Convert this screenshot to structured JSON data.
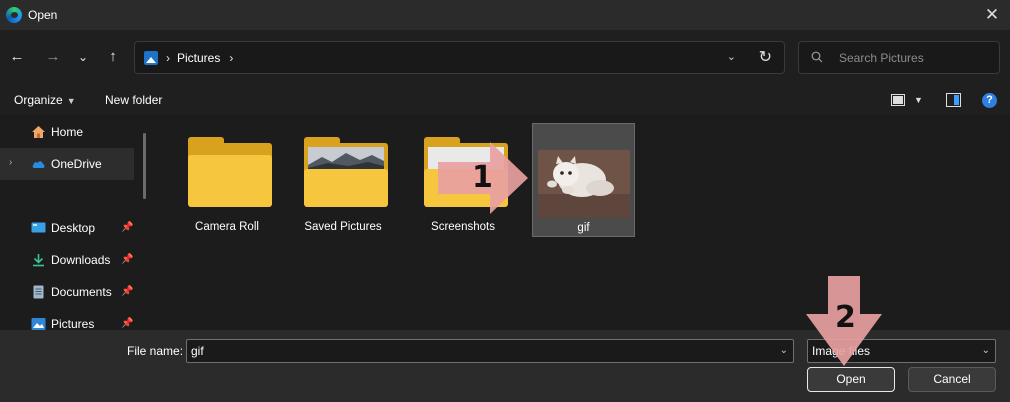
{
  "window": {
    "title": "Open"
  },
  "nav": {
    "breadcrumb_sep": "›",
    "location": "Pictures",
    "location_sep": "›",
    "search_placeholder": "Search Pictures"
  },
  "toolbar": {
    "organize_label": "Organize",
    "new_folder_label": "New folder",
    "help_label": "?"
  },
  "sidebar": {
    "items": [
      {
        "label": "Home",
        "icon": "home-icon",
        "pinned": false
      },
      {
        "label": "OneDrive",
        "icon": "cloud-icon",
        "pinned": false,
        "selected": true
      },
      {
        "label": "Desktop",
        "icon": "desktop-icon",
        "pinned": true
      },
      {
        "label": "Downloads",
        "icon": "download-icon",
        "pinned": true
      },
      {
        "label": "Documents",
        "icon": "document-icon",
        "pinned": true
      },
      {
        "label": "Pictures",
        "icon": "pictures-icon",
        "pinned": true
      }
    ]
  },
  "files": [
    {
      "label": "Camera Roll",
      "type": "folder"
    },
    {
      "label": "Saved Pictures",
      "type": "folder"
    },
    {
      "label": "Screenshots",
      "type": "folder"
    },
    {
      "label": "gif",
      "type": "image",
      "selected": true
    }
  ],
  "footer": {
    "filename_label": "File name:",
    "filename_value": "gif",
    "filetype_value": "Image files",
    "open_label": "Open",
    "cancel_label": "Cancel"
  },
  "annotations": [
    {
      "number": "1",
      "color": "#e8a0a0"
    },
    {
      "number": "2",
      "color": "#e8a0a0"
    }
  ]
}
